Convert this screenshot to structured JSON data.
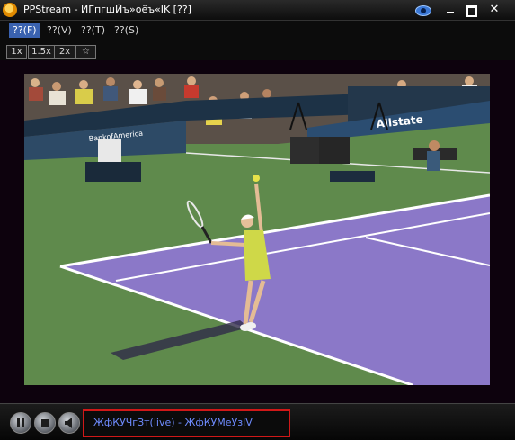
{
  "window": {
    "title": "PPStream - ИГпгшЙъ»оёъ«IK [??]"
  },
  "menu": {
    "items": [
      "??(F)",
      "??(V)",
      "??(T)",
      "??(S)"
    ],
    "active_index": 0
  },
  "playback_rates": [
    "1x",
    "1.5x",
    "2x"
  ],
  "pin_icon": "star-icon",
  "video": {
    "banners": {
      "bank": "BankofAmerica",
      "allstate": "Allstate"
    }
  },
  "controls": {
    "icons": [
      "pause-icon",
      "stop-icon",
      "volume-icon"
    ]
  },
  "status": {
    "text": "ЖфКУЧгЗт(live) - ЖфКУМeУзIV"
  },
  "colors": {
    "menu_active": "#3a62b0",
    "status_text": "#6f8cff",
    "status_border": "#d01818",
    "court_purple": "#8b78c8",
    "court_green": "#5f8a4c"
  }
}
